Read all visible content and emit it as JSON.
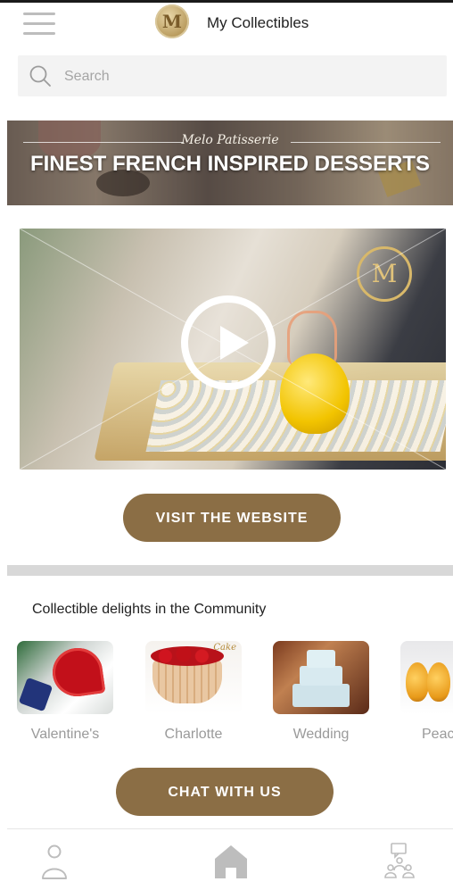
{
  "header": {
    "logo_letter": "M",
    "title": "My Collectibles",
    "menu_icon": "hamburger-menu-icon"
  },
  "search": {
    "placeholder": "Search",
    "icon": "search-icon"
  },
  "banner": {
    "subtitle": "Melo Patisserie",
    "headline": "FINEST FRENCH INSPIRED DESSERTS"
  },
  "video": {
    "play_icon": "play-icon",
    "emblem_letter": "M"
  },
  "actions": {
    "visit_label": "VISIT THE WEBSITE",
    "chat_label": "CHAT WITH US"
  },
  "community": {
    "title": "Collectible delights in the Community",
    "items": [
      {
        "label": "Valentine's"
      },
      {
        "label": "Charlotte",
        "tag": "Cake"
      },
      {
        "label": "Wedding"
      },
      {
        "label": "Peac"
      }
    ]
  },
  "nav": {
    "items": [
      {
        "icon": "profile-icon"
      },
      {
        "icon": "home-icon"
      },
      {
        "icon": "community-icon"
      }
    ]
  },
  "colors": {
    "accent": "#8b6e45",
    "nav_icon": "#bdbdbd"
  }
}
